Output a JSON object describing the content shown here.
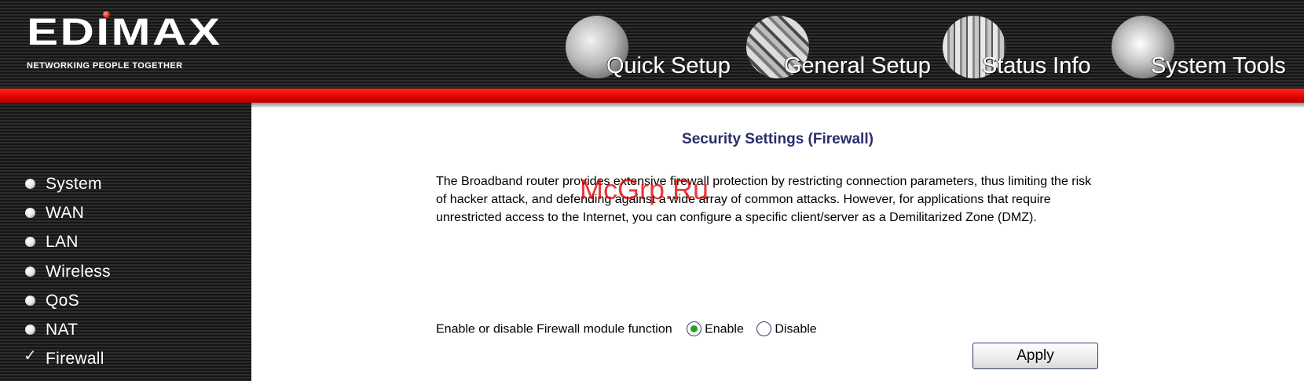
{
  "brand": {
    "logo_text": "EDIMAX",
    "tagline": "NETWORKING PEOPLE TOGETHER"
  },
  "top_nav": [
    {
      "label": "Quick Setup",
      "icon": "quick-setup-icon"
    },
    {
      "label": "General Setup",
      "icon": "general-setup-icon"
    },
    {
      "label": "Status Info",
      "icon": "status-info-icon"
    },
    {
      "label": "System Tools",
      "icon": "system-tools-icon"
    }
  ],
  "sidebar": {
    "items": [
      {
        "label": "System",
        "icon": "bullet-icon"
      },
      {
        "label": "WAN",
        "icon": "bullet-icon"
      },
      {
        "label": "LAN",
        "icon": "bullet-icon"
      },
      {
        "label": "Wireless",
        "icon": "bullet-icon"
      },
      {
        "label": "QoS",
        "icon": "bullet-icon"
      },
      {
        "label": "NAT",
        "icon": "bullet-icon"
      },
      {
        "label": "Firewall",
        "icon": "checkmark-icon",
        "selected": true
      }
    ]
  },
  "main": {
    "title": "Security Settings (Firewall)",
    "description": "The Broadband router provides extensive firewall protection by restricting connection parameters, thus limiting the risk of hacker attack, and defending against a wide array of common attacks. However, for applications that require unrestricted access to the Internet, you can configure a specific client/server as a Demilitarized Zone (DMZ).",
    "firewall_label": "Enable or disable Firewall module function",
    "enable_label": "Enable",
    "disable_label": "Disable",
    "firewall_state": "Enable",
    "apply_label": "Apply"
  },
  "watermark": "McGrp.Ru",
  "colors": {
    "header_dark": "#1a1a1a",
    "accent_red": "#e00000",
    "title_color": "#2c2c6e",
    "radio_selected": "#25a025"
  }
}
